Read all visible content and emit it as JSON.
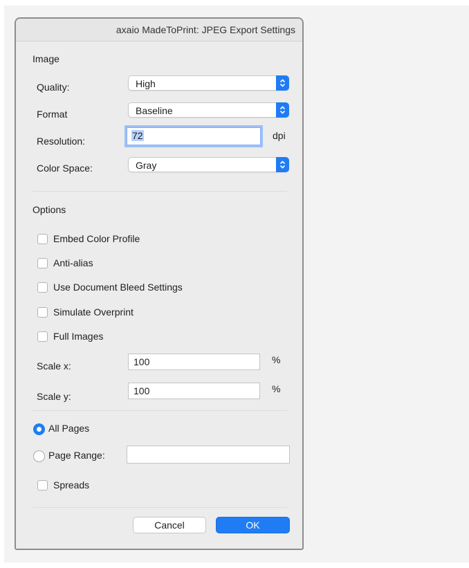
{
  "window": {
    "title": "axaio MadeToPrint:  JPEG Export Settings"
  },
  "image_section": {
    "heading": "Image",
    "quality": {
      "label": "Quality:",
      "value": "High"
    },
    "format": {
      "label": "Format",
      "value": "Baseline"
    },
    "resolution": {
      "label": "Resolution:",
      "value": "72",
      "unit": "dpi"
    },
    "color_space": {
      "label": "Color Space:",
      "value": "Gray"
    }
  },
  "options_section": {
    "heading": "Options",
    "checkboxes": [
      {
        "label": "Embed Color Profile",
        "checked": false
      },
      {
        "label": "Anti-alias",
        "checked": false
      },
      {
        "label": "Use Document Bleed Settings",
        "checked": false
      },
      {
        "label": "Simulate Overprint",
        "checked": false
      },
      {
        "label": "Full Images",
        "checked": false
      }
    ],
    "scale_x": {
      "label": "Scale x:",
      "value": "100",
      "unit": "%"
    },
    "scale_y": {
      "label": "Scale y:",
      "value": "100",
      "unit": "%"
    }
  },
  "pages_section": {
    "all_pages": {
      "label": "All Pages",
      "selected": true
    },
    "page_range": {
      "label": "Page Range:",
      "value": "",
      "selected": false
    },
    "spreads": {
      "label": "Spreads",
      "checked": false
    }
  },
  "buttons": {
    "cancel": "Cancel",
    "ok": "OK"
  },
  "colors": {
    "accent": "#1f7cf4",
    "window_bg": "#ececec"
  }
}
